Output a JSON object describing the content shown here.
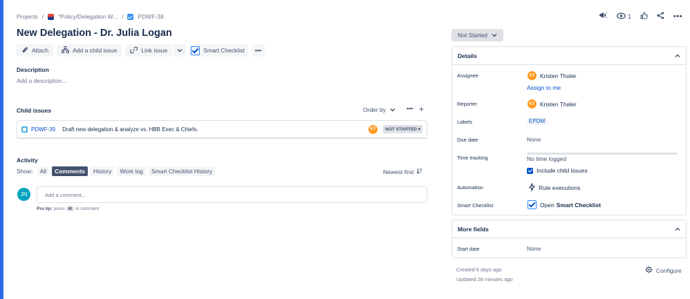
{
  "breadcrumb": {
    "projects": "Projects",
    "separator": "/",
    "project_name": "*Policy/Delegation W...",
    "issue_key": "PDWF-38"
  },
  "header": {
    "watch_count": "1"
  },
  "issue": {
    "title": "New Delegation - Dr. Julia Logan"
  },
  "toolbar": {
    "attach": "Attach",
    "add_child": "Add a child issue",
    "link_issue": "Link issue",
    "smart_checklist": "Smart Checklist"
  },
  "description": {
    "heading": "Description",
    "placeholder": "Add a description..."
  },
  "child_issues": {
    "heading": "Child issues",
    "order_by": "Order by",
    "items": [
      {
        "key": "PDWF-39",
        "summary": "Draft new delegation & analyze vs. HBB Exec & Chiefs.",
        "assignee_initials": "KT",
        "status": "NOT STARTED"
      }
    ]
  },
  "activity": {
    "heading": "Activity",
    "show_label": "Show:",
    "tabs": [
      "All",
      "Comments",
      "History",
      "Work log",
      "Smart Checklist History"
    ],
    "active_tab": "Comments",
    "sort": "Newest first",
    "user_initials": "JN",
    "comment_placeholder": "Add a comment...",
    "pro_tip_label": "Pro tip:",
    "pro_tip_pre": "press",
    "pro_tip_key": "M",
    "pro_tip_post": "to comment"
  },
  "status": {
    "label": "Not Started"
  },
  "details": {
    "heading": "Details",
    "assignee_label": "Assignee",
    "assignee_name": "Kristen Thaler",
    "assignee_initials": "KT",
    "assign_to_me": "Assign to me",
    "reporter_label": "Reporter",
    "reporter_name": "Kristen Thaler",
    "reporter_initials": "KT",
    "labels_label": "Labels",
    "label_value": "EPDM",
    "due_date_label": "Due date",
    "due_date_value": "None",
    "time_tracking_label": "Time tracking",
    "time_tracking_value": "No time logged",
    "include_child": "Include child issues",
    "automation_label": "Automation",
    "automation_value": "Rule executions",
    "smart_checklist_label": "Smart Checklist",
    "smart_checklist_open": "Open",
    "smart_checklist_name": "Smart Checklist"
  },
  "more_fields": {
    "heading": "More fields",
    "start_date_label": "Start date",
    "start_date_value": "None"
  },
  "footer": {
    "created": "Created 6 days ago",
    "updated": "Updated 28 minutes ago",
    "configure": "Configure"
  },
  "colors": {
    "accent": "#0052cc",
    "left_bar": "#2e6be6",
    "avatar_orange": "#ff991f",
    "avatar_teal": "#00a3bf"
  }
}
